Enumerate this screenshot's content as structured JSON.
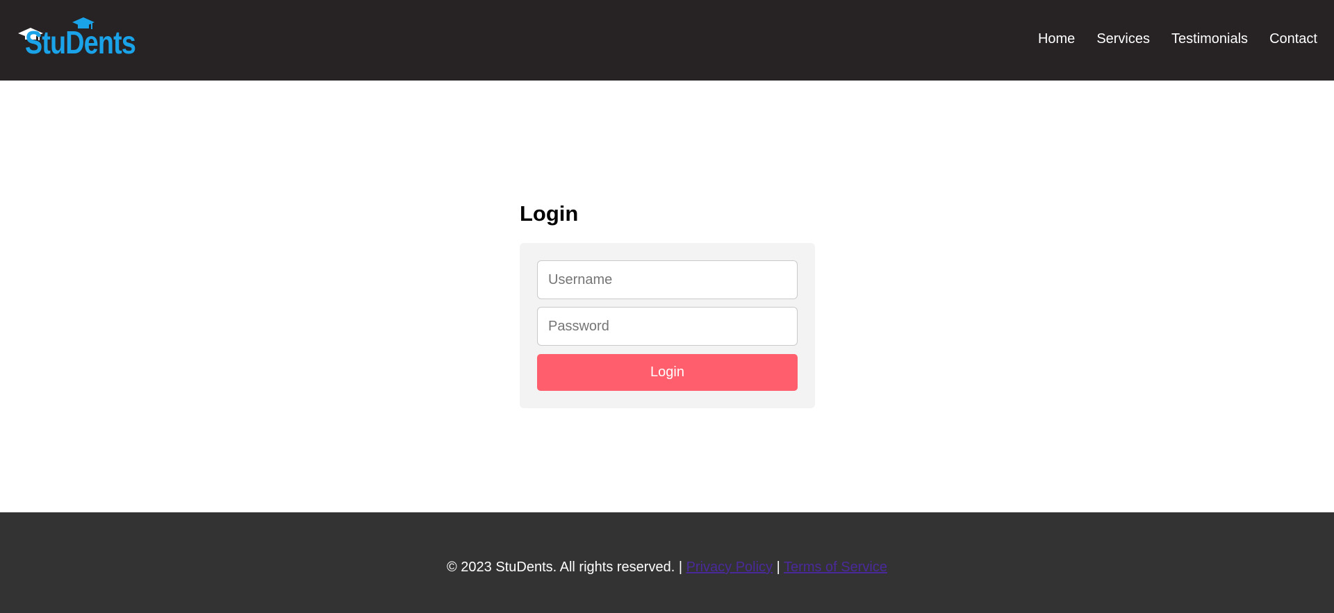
{
  "header": {
    "logo_text": "StuDents",
    "nav": [
      {
        "label": "Home"
      },
      {
        "label": "Services"
      },
      {
        "label": "Testimonials"
      },
      {
        "label": "Contact"
      }
    ]
  },
  "login": {
    "title": "Login",
    "username_placeholder": "Username",
    "password_placeholder": "Password",
    "button_label": "Login"
  },
  "footer": {
    "copyright": "© 2023 StuDents. All rights reserved.",
    "separator": "|",
    "privacy_label": "Privacy Policy",
    "terms_label": "Terms of Service"
  },
  "colors": {
    "header_bg": "#272224",
    "logo_blue": "#1aa3e8",
    "button": "#ff5f6d",
    "footer_bg": "#333333",
    "link": "#4a2a9a"
  },
  "icons": {
    "logo_caps": "graduation-cap-icon"
  }
}
